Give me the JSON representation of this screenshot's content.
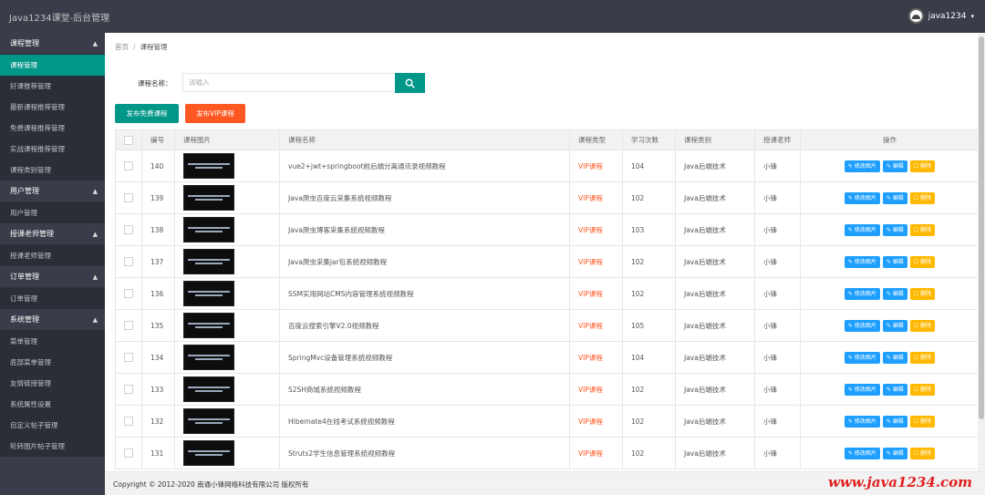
{
  "app_title": "Java1234课堂-后台管理",
  "user": {
    "name": "java1234",
    "caret": "▾"
  },
  "sidebar": {
    "groups": [
      {
        "label": "课程管理",
        "arrow": "▲",
        "items": [
          "课程管理",
          "好课推荐管理",
          "最新课程推荐管理",
          "免费课程推荐管理",
          "实战课程推荐管理",
          "课程类别管理"
        ]
      },
      {
        "label": "用户管理",
        "arrow": "▲",
        "items": [
          "用户管理"
        ]
      },
      {
        "label": "授课老师管理",
        "arrow": "▲",
        "items": [
          "授课老师管理"
        ]
      },
      {
        "label": "订单管理",
        "arrow": "▲",
        "items": [
          "订单管理"
        ]
      },
      {
        "label": "系统管理",
        "arrow": "▲",
        "items": [
          "菜单管理",
          "底部菜单管理",
          "友情链接管理",
          "系统属性设置",
          "自定义帖子管理",
          "轮转图片帖子管理"
        ]
      }
    ]
  },
  "breadcrumb": {
    "home": "首页",
    "sep": "/",
    "current": "课程管理"
  },
  "search": {
    "label": "课程名称：",
    "value": "",
    "placeholder": "请输入"
  },
  "buttons": {
    "publish_free": "发布免费课程",
    "publish_vip": "发布VIP课程"
  },
  "table": {
    "headers": [
      "",
      "编号",
      "课程图片",
      "课程名称",
      "课程类型",
      "学习次数",
      "课程类别",
      "授课老师",
      "操作"
    ],
    "row_actions": [
      "✎ 修改图片",
      "✎ 编辑",
      "☐ 删除"
    ],
    "rows": [
      {
        "id": "140",
        "thumb": "vue2+jwt+springboot前后端分离通讯录视频教程",
        "name": "vue2+jwt+springboot前后端分离通讯录视频教程",
        "type": "VIP课程",
        "views": "104",
        "category": "Java后端技术",
        "teacher": "小锋"
      },
      {
        "id": "139",
        "thumb": "Java爬虫百度云采集系统视频教程",
        "name": "Java爬虫百度云采集系统视频教程",
        "type": "VIP课程",
        "views": "102",
        "category": "Java后端技术",
        "teacher": "小锋"
      },
      {
        "id": "138",
        "thumb": "Java爬虫博客采集系统视频教程",
        "name": "Java爬虫博客采集系统视频教程",
        "type": "VIP课程",
        "views": "103",
        "category": "Java后端技术",
        "teacher": "小锋"
      },
      {
        "id": "137",
        "thumb": "Java爬虫采集jar包系统视频教程",
        "name": "Java爬虫采集jar包系统视频教程",
        "type": "VIP课程",
        "views": "102",
        "category": "Java后端技术",
        "teacher": "小锋"
      },
      {
        "id": "136",
        "thumb": "SSM实用网站CMS内容管理系统视频教程",
        "name": "SSM实用网站CMS内容管理系统视频教程",
        "type": "VIP课程",
        "views": "102",
        "category": "Java后端技术",
        "teacher": "小锋"
      },
      {
        "id": "135",
        "thumb": "百度云搜索引擎V2.0视频教程",
        "name": "百度云搜索引擎V2.0视频教程",
        "type": "VIP课程",
        "views": "105",
        "category": "Java后端技术",
        "teacher": "小锋"
      },
      {
        "id": "134",
        "thumb": "SpringMvc设备管理系统视频教程",
        "name": "SpringMvc设备管理系统视频教程",
        "type": "VIP课程",
        "views": "104",
        "category": "Java后端技术",
        "teacher": "小锋"
      },
      {
        "id": "133",
        "thumb": "S2SH商城系统视频教程",
        "name": "S2SH商城系统视频教程",
        "type": "VIP课程",
        "views": "102",
        "category": "Java后端技术",
        "teacher": "小锋"
      },
      {
        "id": "132",
        "thumb": "Hibernate4在线考试系统视频教程",
        "name": "Hibernate4在线考试系统视频教程",
        "type": "VIP课程",
        "views": "102",
        "category": "Java后端技术",
        "teacher": "小锋"
      },
      {
        "id": "131",
        "thumb": "Struts2学生信息管理系统视频教程",
        "name": "Struts2学生信息管理系统视频教程",
        "type": "VIP课程",
        "views": "102",
        "category": "Java后端技术",
        "teacher": "小锋"
      }
    ]
  },
  "footer": {
    "copyright": "Copyright © 2012-2020 南通小锋网络科技有限公司 版权所有",
    "watermark": "www.java1234.com"
  },
  "colors": {
    "sidebar_bg": "#393d49",
    "active": "#009688",
    "vip": "#ff5722",
    "blue_btn": "#1e9fff",
    "yellow_btn": "#ffb800"
  },
  "icons": {
    "search": "search-icon",
    "avatar": "avatar-icon",
    "edit": "edit-icon",
    "delete": "delete-icon"
  }
}
